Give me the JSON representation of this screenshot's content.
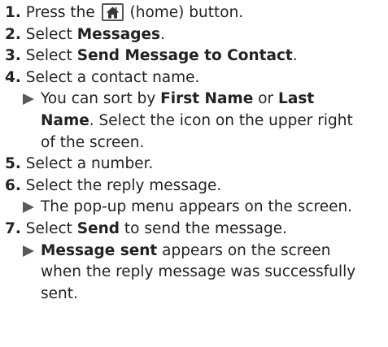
{
  "steps": [
    {
      "num": "1.",
      "pre": "Press the",
      "post": "(home) button.",
      "icon": "home-icon"
    },
    {
      "num": "2.",
      "pre": "Select ",
      "bold": "Messages",
      "post": "."
    },
    {
      "num": "3.",
      "pre": "Select ",
      "bold": "Send Message to Contact",
      "post": "."
    },
    {
      "num": "4.",
      "text": "Select a contact name.",
      "note": {
        "line1_pre": "You can sort by ",
        "line1_bold1": "First Name",
        "line1_mid": " or ",
        "line1_bold2": "Last",
        "line2_bold": "Name",
        "line2_post": ". Select the icon on the upper right",
        "line3": "of the screen."
      }
    },
    {
      "num": "5.",
      "text": "Select a number."
    },
    {
      "num": "6.",
      "text": "Select the reply message.",
      "note": {
        "line1": "The pop-up menu appears on the screen."
      }
    },
    {
      "num": "7.",
      "pre": "Select ",
      "bold": "Send",
      "post": " to send the message.",
      "note": {
        "line1_bold": "Message sent",
        "line1_post": " appears on the screen",
        "line2": "when the reply message was successfully",
        "line3": "sent."
      }
    }
  ],
  "colors": {
    "text": "#222222",
    "arrow": "#5a5a5a",
    "icon": "#555555"
  }
}
